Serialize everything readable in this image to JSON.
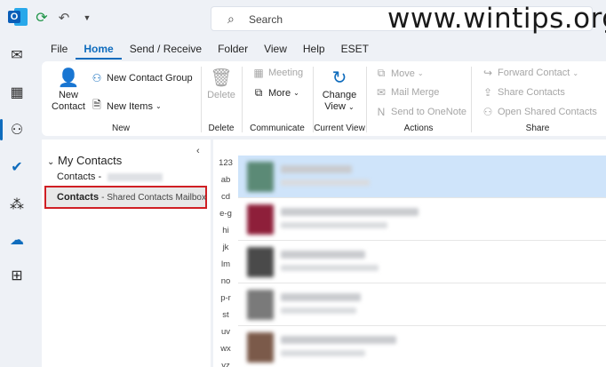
{
  "titlebar": {
    "search_placeholder": "Search",
    "watermark": "www.wintips.org"
  },
  "menu": {
    "tabs": [
      "File",
      "Home",
      "Send / Receive",
      "Folder",
      "View",
      "Help",
      "ESET"
    ],
    "active_tab": "Home"
  },
  "ribbon": {
    "new_group": {
      "new_contact": [
        "New",
        "Contact"
      ],
      "new_contact_group": "New Contact Group",
      "new_items": "New Items",
      "label": "New"
    },
    "delete_group": {
      "delete": "Delete",
      "label": "Delete"
    },
    "communicate_group": {
      "meeting": "Meeting",
      "more": "More",
      "label": "Communicate"
    },
    "current_view_group": {
      "change_view": [
        "Change",
        "View"
      ],
      "label": "Current View"
    },
    "actions_group": {
      "move": "Move",
      "mail_merge": "Mail Merge",
      "send_to_onenote": "Send to OneNote",
      "label": "Actions"
    },
    "share_group": {
      "forward_contact": "Forward Contact",
      "share_contacts": "Share Contacts",
      "open_shared_contacts": "Open Shared Contacts",
      "label": "Share"
    }
  },
  "folder_pane": {
    "header": "My Contacts",
    "items": [
      {
        "name": "Contacts",
        "suffix": "-"
      },
      {
        "name": "Contacts",
        "suffix": "- Shared Contacts Mailbox"
      }
    ]
  },
  "index": [
    "123",
    "ab",
    "cd",
    "e-g",
    "hi",
    "jk",
    "lm",
    "no",
    "p-r",
    "st",
    "uv",
    "wx",
    "yz"
  ],
  "contacts": [
    {
      "avatar_color": "#5b8a76",
      "selected": true
    },
    {
      "avatar_color": "#8e1f3a",
      "selected": false
    },
    {
      "avatar_color": "#4a4a4a",
      "selected": false
    },
    {
      "avatar_color": "#7a7a7a",
      "selected": false
    },
    {
      "avatar_color": "#7b5a4a",
      "selected": false
    }
  ],
  "colors": {
    "accent": "#0f6cbd",
    "highlight_border": "#d01f24",
    "selected_row": "#cfe4fa"
  }
}
